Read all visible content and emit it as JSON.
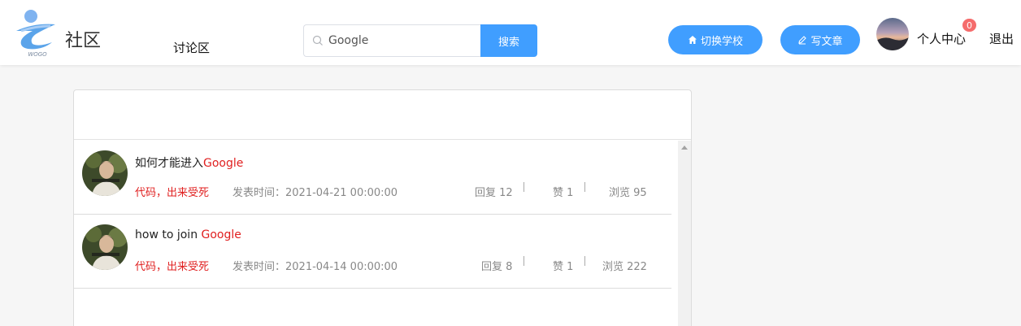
{
  "header": {
    "logo_title": "社区",
    "logo_sub": "WOGO",
    "nav_discuss": "讨论区",
    "search": {
      "value": "Google",
      "button": "搜索"
    },
    "btn_switch_school": "切换学校",
    "btn_write_article": "写文章",
    "profile_label": "个人中心",
    "badge_count": "0",
    "logout_label": "退出"
  },
  "posts": [
    {
      "title_prefix": "如何才能进入",
      "title_keyword": "Google",
      "author": "代码，出来受死",
      "time": "发表时间：2021-04-21 00:00:00",
      "replies": "回复 12",
      "likes": "赞 1",
      "views": "浏览 95"
    },
    {
      "title_prefix": "how to join ",
      "title_keyword": "Google",
      "author": "代码，出来受死",
      "time": "发表时间：2021-04-14 00:00:00",
      "replies": "回复 8",
      "likes": "赞 1",
      "views": "浏览 222"
    }
  ],
  "colors": {
    "primary": "#409eff",
    "keyword": "#e02020",
    "badge": "#f56c6c"
  }
}
